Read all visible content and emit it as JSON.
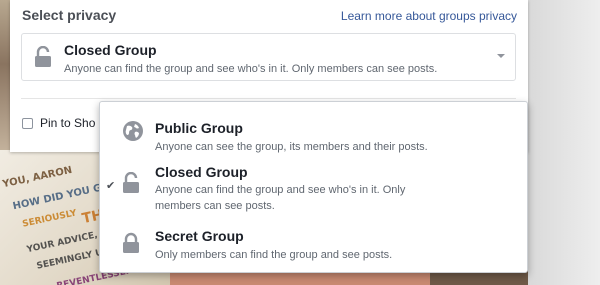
{
  "header": {
    "title": "Select privacy",
    "learn_more": "Learn more about groups privacy"
  },
  "selected": {
    "title": "Closed Group",
    "description": "Anyone can find the group and see who's in it. Only members can see posts."
  },
  "pin": {
    "label": "Pin to Sho"
  },
  "menu": {
    "options": [
      {
        "title": "Public Group",
        "description": "Anyone can see the group, its members and their posts.",
        "icon": "globe-icon"
      },
      {
        "title": "Closed Group",
        "description_line1": "Anyone can find the group and see who's in it. Only",
        "description_line2": "members can see posts.",
        "icon": "unlocked-lock-icon",
        "checked": true
      },
      {
        "title": "Secret Group",
        "description": "Only members can find the group and see posts.",
        "icon": "locked-lock-icon"
      }
    ],
    "check_mark": "✔"
  },
  "colors": {
    "link": "#365899",
    "title": "#1d2129",
    "secondary": "#606770",
    "icon_gray": "#90949c"
  },
  "background_text": {
    "fragments": [
      "YOU, AARON",
      "HOW DID YOU G",
      "SERIOUSLY",
      "THA",
      "YOUR ADVICE, GE",
      "SEEMINGLY UN",
      "REVENTLESSLY"
    ]
  }
}
